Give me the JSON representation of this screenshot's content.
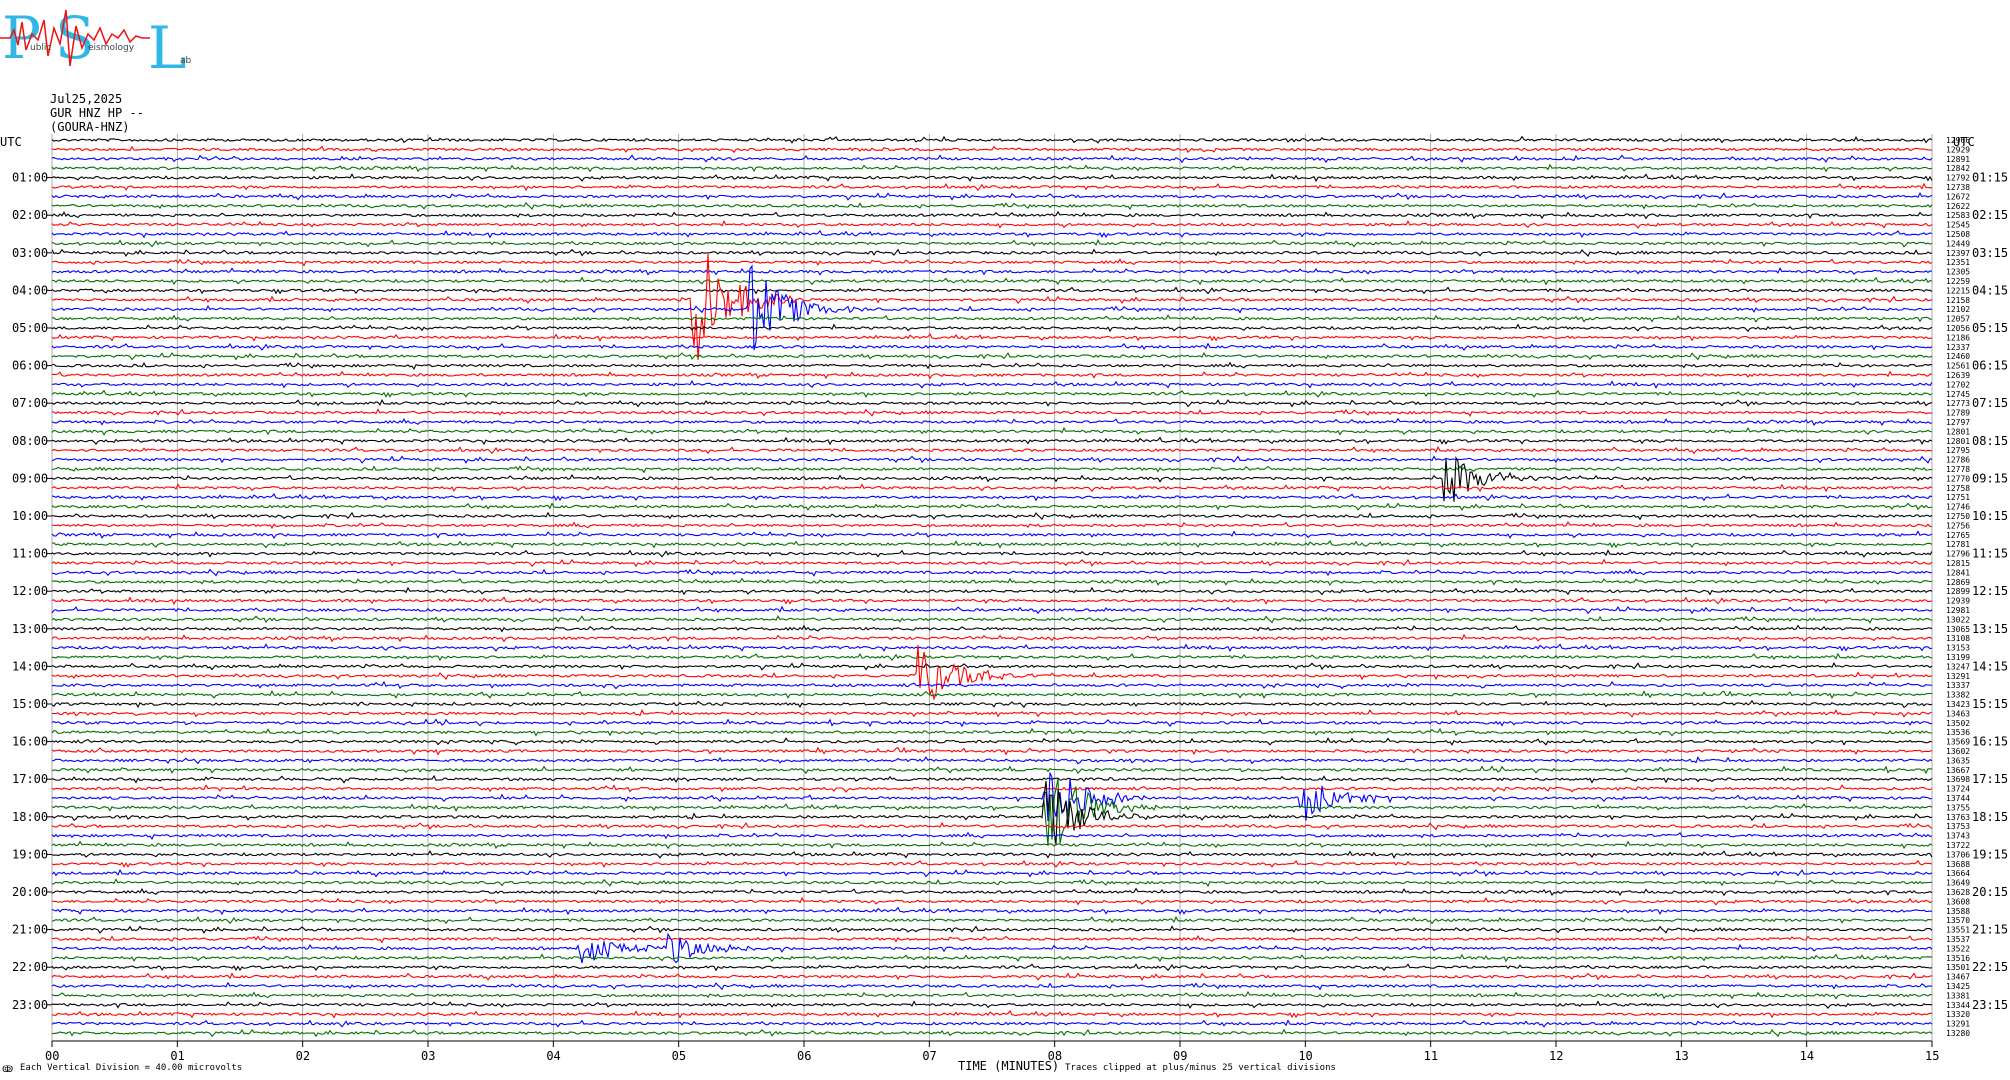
{
  "logo": {
    "letters": [
      "P",
      "S",
      "L"
    ],
    "full": "Public Seismology Lab",
    "fragments": [
      "ublic",
      "eismology",
      "ab"
    ]
  },
  "header": {
    "date": "Jul25,2025",
    "channel": "GUR HNZ HP --",
    "station": "(GOURA-HNZ)"
  },
  "chart_data": {
    "type": "line",
    "title": "",
    "xlabel": "TIME (MINUTES)",
    "ylabel": "",
    "x_ticks": [
      "00",
      "01",
      "02",
      "03",
      "04",
      "05",
      "06",
      "07",
      "08",
      "09",
      "10",
      "11",
      "12",
      "13",
      "14",
      "15"
    ],
    "xlim": [
      0,
      15
    ],
    "left_axis_label": "UTC",
    "right_axis_label": "UTC",
    "left_hour_labels": [
      "01:00",
      "02:00",
      "03:00",
      "04:00",
      "05:00",
      "06:00",
      "07:00",
      "08:00",
      "09:00",
      "10:00",
      "11:00",
      "12:00",
      "13:00",
      "14:00",
      "15:00",
      "16:00",
      "17:00",
      "18:00",
      "19:00",
      "20:00",
      "21:00",
      "22:00",
      "23:00"
    ],
    "right_hour_labels": [
      "01:15",
      "02:15",
      "03:15",
      "04:15",
      "05:15",
      "06:15",
      "07:15",
      "08:15",
      "09:15",
      "10:15",
      "11:15",
      "12:15",
      "13:15",
      "14:15",
      "15:15",
      "16:15",
      "17:15",
      "18:15",
      "19:15",
      "20:15",
      "21:15",
      "22:15",
      "23:15"
    ],
    "trace_colors": [
      "#000000",
      "#ff0000",
      "#0000ff",
      "#007000"
    ],
    "trace_count": 96,
    "trace_offsets": [
      12966,
      12929,
      12891,
      12842,
      12792,
      12738,
      12672,
      12622,
      12583,
      12545,
      12508,
      12449,
      12397,
      12351,
      12305,
      12259,
      12215,
      12158,
      12102,
      12057,
      12056,
      12186,
      12337,
      12460,
      12561,
      12639,
      12702,
      12745,
      12773,
      12789,
      12797,
      12801,
      12801,
      12795,
      12786,
      12778,
      12770,
      12758,
      12751,
      12746,
      12750,
      12756,
      12765,
      12781,
      12796,
      12815,
      12841,
      12869,
      12899,
      12939,
      12981,
      13022,
      13065,
      13108,
      13153,
      13199,
      13247,
      13291,
      13337,
      13382,
      13423,
      13463,
      13502,
      13536,
      13569,
      13602,
      13635,
      13667,
      13698,
      13724,
      13744,
      13755,
      13763,
      13753,
      13743,
      13722,
      13706,
      13688,
      13664,
      13649,
      13628,
      13608,
      13588,
      13570,
      13551,
      13537,
      13522,
      13516,
      13501,
      13467,
      13425,
      13381,
      13344,
      13320,
      13291,
      13280
    ],
    "events": [
      {
        "trace": 17,
        "minute": 5.15,
        "amp": 2.4
      },
      {
        "trace": 18,
        "minute": 5.6,
        "amp": 1.6
      },
      {
        "trace": 36,
        "minute": 11.15,
        "amp": 1.0
      },
      {
        "trace": 57,
        "minute": 6.95,
        "amp": 1.2
      },
      {
        "trace": 70,
        "minute": 7.95,
        "amp": 1.4
      },
      {
        "trace": 71,
        "minute": 7.95,
        "amp": 1.8
      },
      {
        "trace": 72,
        "minute": 7.95,
        "amp": 1.4
      },
      {
        "trace": 70,
        "minute": 10.0,
        "amp": 0.8
      },
      {
        "trace": 86,
        "minute": 4.25,
        "amp": 0.6
      },
      {
        "trace": 86,
        "minute": 4.95,
        "amp": 0.6
      }
    ]
  },
  "footer": {
    "scale_note": "Each Vertical Division =   40.00 microvolts",
    "clip_note": "Traces clipped at plus/minus 25 vertical divisions",
    "corner_mark": "ↂ"
  }
}
